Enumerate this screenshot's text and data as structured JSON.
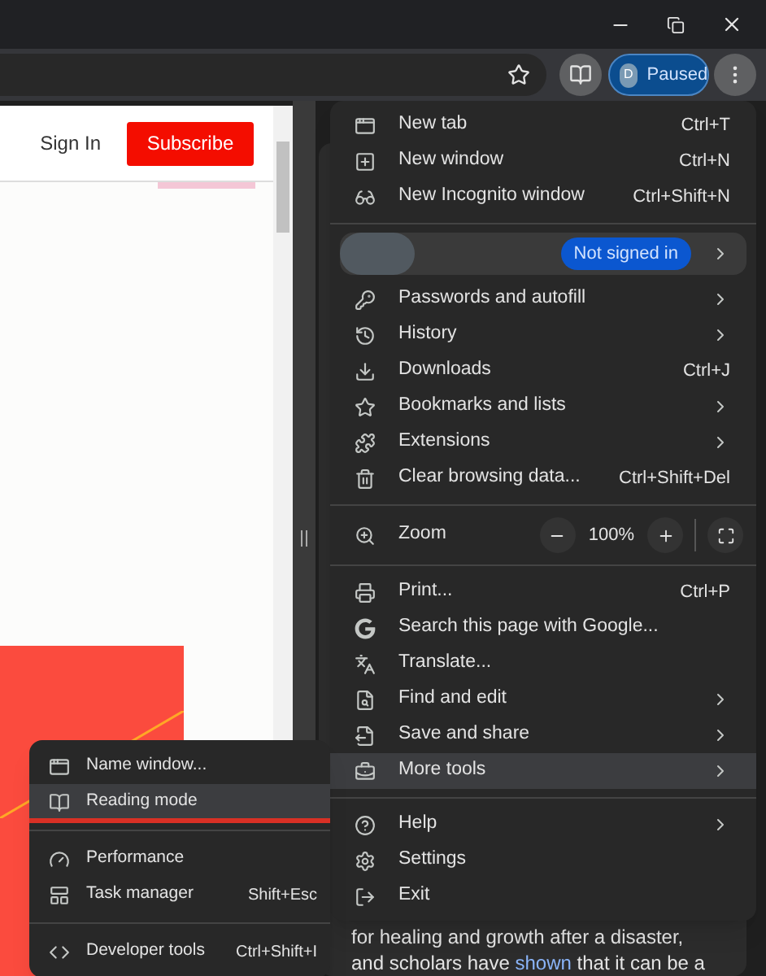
{
  "toolbar": {
    "profile": {
      "initial": "D",
      "label": "Paused"
    }
  },
  "page": {
    "sign_in": "Sign In",
    "subscribe": "Subscribe"
  },
  "side_panel": {
    "lines": [
      {
        "before": "for healing and growth after a disaster,"
      },
      {
        "before": "and scholars have ",
        "link": "shown",
        "after": " that it can be a"
      }
    ]
  },
  "menu": {
    "items": [
      {
        "kind": "item",
        "label": "New tab",
        "shortcut": "Ctrl+T",
        "submenu": false,
        "selected": false
      },
      {
        "kind": "item",
        "label": "New window",
        "shortcut": "Ctrl+N",
        "submenu": false,
        "selected": false
      },
      {
        "kind": "item",
        "label": "New Incognito window",
        "shortcut": "Ctrl+Shift+N",
        "submenu": false,
        "selected": false
      },
      {
        "kind": "divider"
      },
      {
        "kind": "profile",
        "badge": "Not signed in"
      },
      {
        "kind": "item",
        "label": "Passwords and autofill",
        "submenu": true,
        "selected": false
      },
      {
        "kind": "item",
        "label": "History",
        "submenu": true,
        "selected": false
      },
      {
        "kind": "item",
        "label": "Downloads",
        "shortcut": "Ctrl+J",
        "submenu": false,
        "selected": false
      },
      {
        "kind": "item",
        "label": "Bookmarks and lists",
        "submenu": true,
        "selected": false
      },
      {
        "kind": "item",
        "label": "Extensions",
        "submenu": true,
        "selected": false
      },
      {
        "kind": "item",
        "label": "Clear browsing data...",
        "shortcut": "Ctrl+Shift+Del",
        "submenu": false,
        "selected": false
      },
      {
        "kind": "divider"
      },
      {
        "kind": "zoom",
        "label": "Zoom",
        "value": "100%"
      },
      {
        "kind": "divider"
      },
      {
        "kind": "item",
        "label": "Print...",
        "shortcut": "Ctrl+P",
        "submenu": false,
        "selected": false
      },
      {
        "kind": "item",
        "label": "Search this page with Google...",
        "submenu": false,
        "selected": false
      },
      {
        "kind": "item",
        "label": "Translate...",
        "submenu": false,
        "selected": false
      },
      {
        "kind": "item",
        "label": "Find and edit",
        "submenu": true,
        "selected": false
      },
      {
        "kind": "item",
        "label": "Save and share",
        "submenu": true,
        "selected": false
      },
      {
        "kind": "item",
        "label": "More tools",
        "submenu": true,
        "selected": true
      },
      {
        "kind": "divider"
      },
      {
        "kind": "item",
        "label": "Help",
        "submenu": true,
        "selected": false
      },
      {
        "kind": "item",
        "label": "Settings",
        "submenu": false,
        "selected": false
      },
      {
        "kind": "item",
        "label": "Exit",
        "submenu": false,
        "selected": false
      }
    ]
  },
  "submenu": {
    "items": [
      {
        "kind": "item",
        "label": "Name window...",
        "selected": false,
        "underlined": false
      },
      {
        "kind": "item",
        "label": "Reading mode",
        "selected": true,
        "underlined": true
      },
      {
        "kind": "divider"
      },
      {
        "kind": "item",
        "label": "Performance",
        "selected": false,
        "underlined": false
      },
      {
        "kind": "item",
        "label": "Task manager",
        "shortcut": "Shift+Esc",
        "selected": false,
        "underlined": false
      },
      {
        "kind": "divider"
      },
      {
        "kind": "item",
        "label": "Developer tools",
        "shortcut": "Ctrl+Shift+I",
        "selected": false,
        "underlined": false
      }
    ]
  }
}
